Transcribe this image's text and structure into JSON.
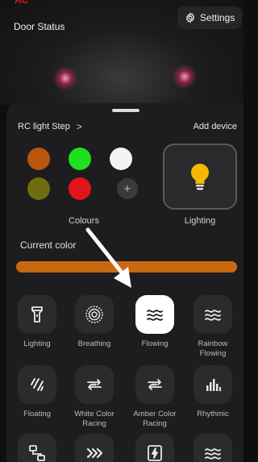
{
  "camera": {
    "brand_logo": "AC",
    "door_status": "Door Status",
    "settings_label": "Settings"
  },
  "device": {
    "room_name": "RC light Step",
    "chevron": ">",
    "add_device": "Add device"
  },
  "colours": {
    "label": "Colours",
    "swatches": [
      "#b8560e",
      "#1fe01f",
      "#f4f4f4",
      "#6e6e10",
      "#e0141a"
    ],
    "add_symbol": "+"
  },
  "lighting_card": {
    "label": "Lighting",
    "icon": "lightbulb-icon",
    "bulb_color": "#f5b800"
  },
  "current_color": {
    "label": "Current color",
    "value": "#c8690f"
  },
  "effects": [
    {
      "label": "Lighting",
      "icon": "flashlight-icon",
      "active": false
    },
    {
      "label": "Breathing",
      "icon": "concentric-circles-icon",
      "active": false
    },
    {
      "label": "Flowing",
      "icon": "waves-icon",
      "active": true
    },
    {
      "label": "Rainbow Flowing",
      "icon": "waves-icon",
      "active": false
    },
    {
      "label": "Floating",
      "icon": "floating-icon",
      "active": false
    },
    {
      "label": "White Color Racing",
      "icon": "racing-icon",
      "active": false
    },
    {
      "label": "Amber Color Racing",
      "icon": "racing-icon",
      "active": false
    },
    {
      "label": "Rhythmic",
      "icon": "equalizer-icon",
      "active": false
    },
    {
      "label": "",
      "icon": "flowchart-icon",
      "active": false
    },
    {
      "label": "",
      "icon": "fast-forward-icon",
      "active": false
    },
    {
      "label": "",
      "icon": "flash-icon",
      "active": false
    },
    {
      "label": "",
      "icon": "waves-icon",
      "active": false
    }
  ]
}
